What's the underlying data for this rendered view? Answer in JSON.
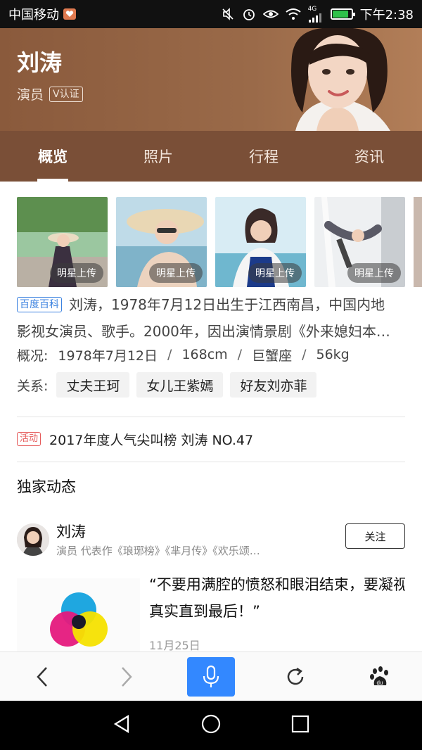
{
  "status_bar": {
    "carrier": "中国移动",
    "network": "4G",
    "time": "下午2:38",
    "battery_level": 0.85,
    "icons": [
      "mute-icon",
      "alarm-icon",
      "eye-icon",
      "wifi-icon",
      "signal-icon",
      "battery-icon"
    ]
  },
  "header": {
    "name": "刘涛",
    "role": "演员",
    "verified_label": "V认证"
  },
  "tabs": [
    {
      "label": "概览",
      "active": true
    },
    {
      "label": "照片",
      "active": false
    },
    {
      "label": "行程",
      "active": false
    },
    {
      "label": "资讯",
      "active": false
    }
  ],
  "photos": [
    {
      "tag": "明星上传"
    },
    {
      "tag": "明星上传"
    },
    {
      "tag": "明星上传"
    },
    {
      "tag": "明星上传"
    }
  ],
  "intro": {
    "source_badge": "百度百科",
    "line1": "刘涛，1978年7月12日出生于江西南昌，中国内地",
    "line2": "影视女演员、歌手。2000年，因出演情景剧《外来媳妇本…"
  },
  "overview": {
    "label": "概况:",
    "birthday": "1978年7月12日",
    "height": "168cm",
    "zodiac": "巨蟹座",
    "weight": "56kg",
    "separator": "/"
  },
  "relations": {
    "label": "关系:",
    "items": [
      "丈夫王珂",
      "女儿王紫嫣",
      "好友刘亦菲"
    ]
  },
  "event": {
    "badge": "活动",
    "text": "2017年度人气尖叫榜 刘涛 NO.47"
  },
  "feed": {
    "section_title": "独家动态",
    "author_name": "刘涛",
    "author_desc": "演员 代表作《琅琊榜》《芈月传》《欢乐颂…",
    "follow_label": "关注",
    "post_text": "“不要用满腔的愤怒和眼泪结束，要凝视真实直到最后！”",
    "post_date": "11月25日"
  },
  "toolbar": {
    "icons": [
      "back-icon",
      "forward-icon",
      "microphone-icon",
      "refresh-icon",
      "baidu-paw-icon"
    ],
    "accent": "#3388ff"
  },
  "nav_bar": {
    "icons": [
      "nav-back-icon",
      "nav-home-icon",
      "nav-recents-icon"
    ]
  }
}
